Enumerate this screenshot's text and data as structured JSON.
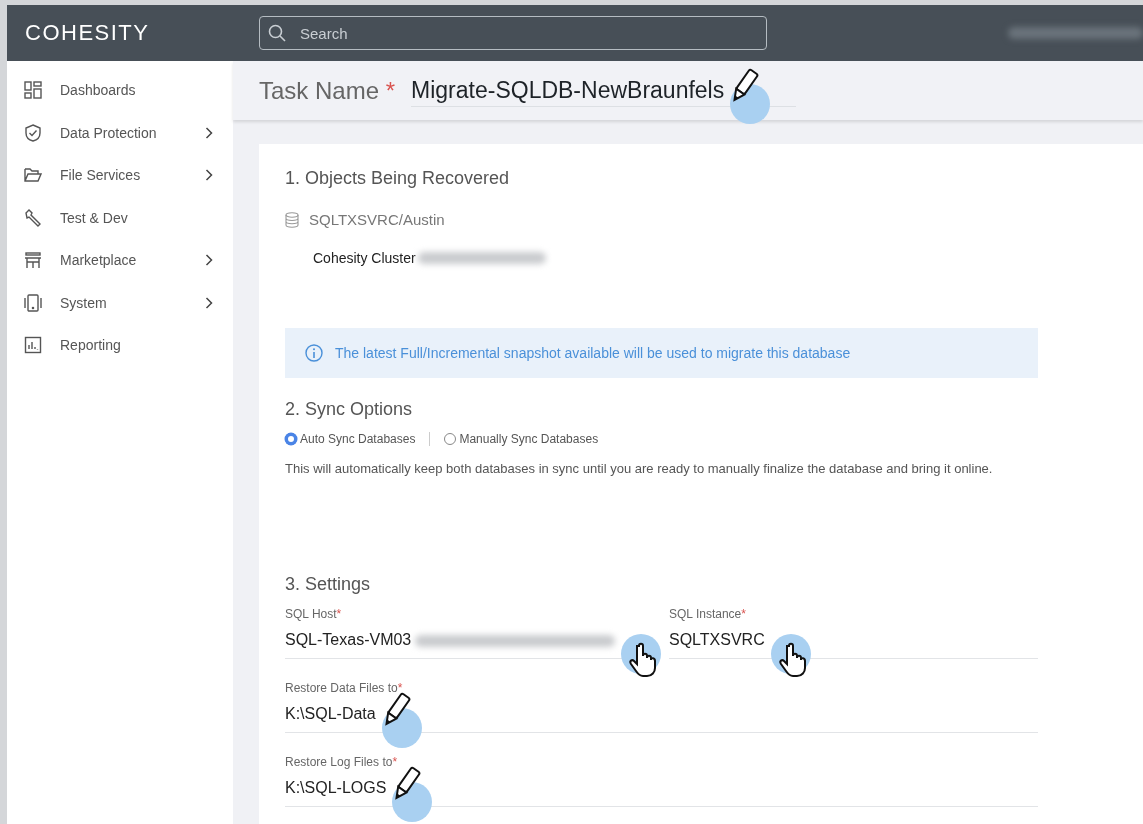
{
  "header": {
    "logo": "COHESITY",
    "search": {
      "placeholder": "Search"
    }
  },
  "sidebar": {
    "items": [
      {
        "label": "Dashboards",
        "has_submenu": false
      },
      {
        "label": "Data Protection",
        "has_submenu": true
      },
      {
        "label": "File Services",
        "has_submenu": true
      },
      {
        "label": "Test & Dev",
        "has_submenu": false
      },
      {
        "label": "Marketplace",
        "has_submenu": true
      },
      {
        "label": "System",
        "has_submenu": true
      },
      {
        "label": "Reporting",
        "has_submenu": false
      }
    ]
  },
  "task_name": {
    "label": "Task Name",
    "required_mark": "*",
    "value": "Migrate-SQLDB-NewBraunfels"
  },
  "objects_section": {
    "title": "1. Objects Being Recovered",
    "object": "SQLTXSVRC/Austin",
    "cluster_label": "Cohesity Cluster",
    "info": "The latest Full/Incremental snapshot available will be used to migrate this database"
  },
  "sync_section": {
    "title": "2. Sync Options",
    "options": [
      {
        "label": "Auto Sync Databases",
        "selected": true
      },
      {
        "label": "Manually Sync Databases",
        "selected": false
      }
    ],
    "description": "This will automatically keep both databases in sync until you are ready to manually finalize the database and bring it online."
  },
  "settings_section": {
    "title": "3. Settings",
    "rows": [
      [
        {
          "label": "SQL Host",
          "required_mark": "*",
          "value": "SQL-Texas-VM03",
          "blurred_suffix": true
        },
        {
          "label": "SQL Instance",
          "required_mark": "*",
          "value": "SQLTXSVRC",
          "blurred_suffix": false
        }
      ],
      [
        {
          "label": "Restore Data Files to",
          "required_mark": "*",
          "value": "K:\\SQL-Data",
          "blurred_suffix": false
        }
      ],
      [
        {
          "label": "Restore Log Files to",
          "required_mark": "*",
          "value": "K:\\SQL-LOGS",
          "blurred_suffix": false
        }
      ]
    ]
  }
}
